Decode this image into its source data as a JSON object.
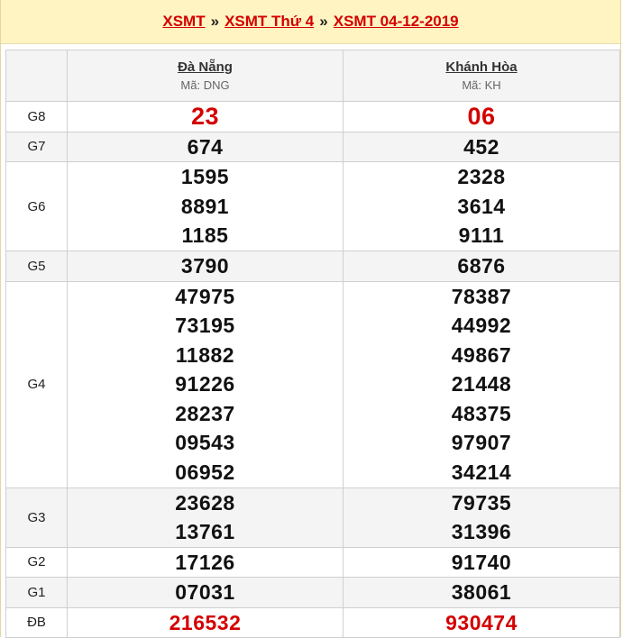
{
  "header": {
    "crumb1": "XSMT",
    "crumb2": "XSMT Thứ 4",
    "crumb3": "XSMT 04-12-2019",
    "separator": "»"
  },
  "provinces": [
    {
      "name": "Đà Nẵng",
      "code": "Mã: DNG"
    },
    {
      "name": "Khánh Hòa",
      "code": "Mã: KH"
    }
  ],
  "prizes": [
    {
      "label": "G8",
      "dng": [
        "23"
      ],
      "kh": [
        "06"
      ]
    },
    {
      "label": "G7",
      "dng": [
        "674"
      ],
      "kh": [
        "452"
      ]
    },
    {
      "label": "G6",
      "dng": [
        "1595",
        "8891",
        "1185"
      ],
      "kh": [
        "2328",
        "3614",
        "9111"
      ]
    },
    {
      "label": "G5",
      "dng": [
        "3790"
      ],
      "kh": [
        "6876"
      ]
    },
    {
      "label": "G4",
      "dng": [
        "47975",
        "73195",
        "11882",
        "91226",
        "28237",
        "09543",
        "06952"
      ],
      "kh": [
        "78387",
        "44992",
        "49867",
        "21448",
        "48375",
        "97907",
        "34214"
      ]
    },
    {
      "label": "G3",
      "dng": [
        "23628",
        "13761"
      ],
      "kh": [
        "79735",
        "31396"
      ]
    },
    {
      "label": "G2",
      "dng": [
        "17126"
      ],
      "kh": [
        "91740"
      ]
    },
    {
      "label": "G1",
      "dng": [
        "07031"
      ],
      "kh": [
        "38061"
      ]
    },
    {
      "label": "ĐB",
      "dng": [
        "216532"
      ],
      "kh": [
        "930474"
      ]
    }
  ],
  "colors": {
    "accent": "#d40000",
    "header_bg": "#fff4c2",
    "alt_row": "#f4f4f4"
  }
}
